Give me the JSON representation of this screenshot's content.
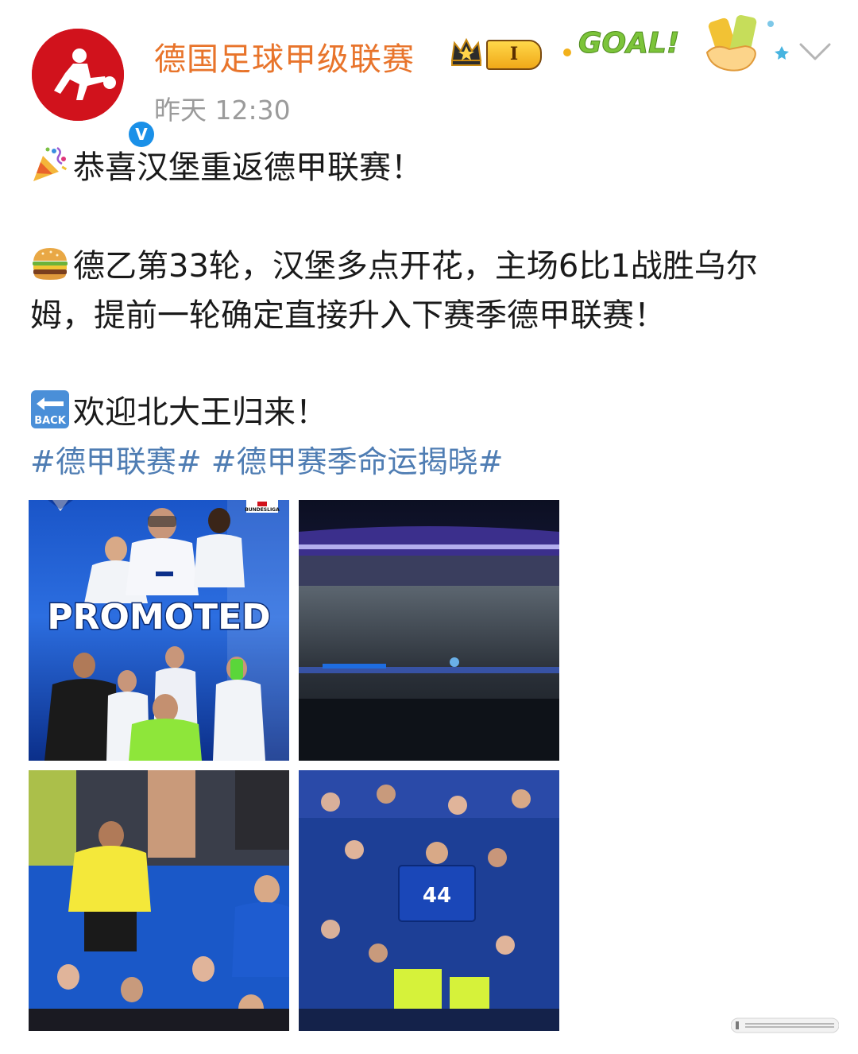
{
  "post": {
    "author": "德国足球甲级联赛",
    "level_badge": "I",
    "goal_badge_text": "GOAL!",
    "timestamp": "昨天 12:30",
    "lines": [
      "恭喜汉堡重返德甲联赛！",
      "德乙第33轮，汉堡多点开花，主场6比1战胜乌尔",
      "姆，提前一轮确定直接升入下赛季德甲联赛！",
      "欢迎北大王归来！"
    ],
    "hashtags": [
      "#德甲联赛#",
      "#德甲赛季命运揭晓#"
    ],
    "emoji_icons": [
      "party-popper-icon",
      "hamburger-icon",
      "back-arrow-icon"
    ]
  },
  "images": {
    "promoted_text": "PROMOTED",
    "bundesliga_label": "BUNDESLIGA",
    "jersey_number": "44",
    "back_label": "BACK"
  },
  "colors": {
    "author": "#e8742b",
    "hashtag": "#4f7db3",
    "timestamp": "#9b9b9b",
    "hsv_blue": "#0a3fa8",
    "avatar_red": "#d1121c"
  }
}
